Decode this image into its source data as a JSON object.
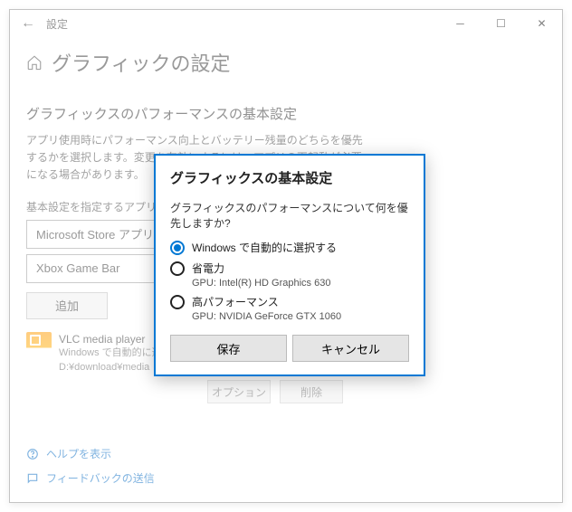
{
  "titlebar": {
    "title": "設定"
  },
  "page": {
    "heading": "グラフィックの設定",
    "subhead": "グラフィックスのパフォーマンスの基本設定",
    "desc": "アプリ使用時にパフォーマンス向上とバッテリー残量のどちらを優先するかを選択します。変更を有効にするには、アプリの再起動が必要になる場合があります。",
    "label": "基本設定を指定するアプリを選択します",
    "dropdown1": "Microsoft Store アプリ",
    "dropdown2": "Xbox Game Bar",
    "add": "追加",
    "app": {
      "name": "VLC media player",
      "sub1": "Windows で自動的に選択",
      "sub2": "D:¥download¥media"
    },
    "btn_option": "オプション",
    "btn_remove": "削除"
  },
  "footer": {
    "help": "ヘルプを表示",
    "feedback": "フィードバックの送信"
  },
  "dialog": {
    "title": "グラフィックスの基本設定",
    "question": "グラフィックスのパフォーマンスについて何を優先しますか?",
    "opt_auto": "Windows で自動的に選択する",
    "opt_power": "省電力",
    "gpu_power": "GPU: Intel(R) HD Graphics 630",
    "opt_perf": "高パフォーマンス",
    "gpu_perf": "GPU: NVIDIA GeForce GTX 1060",
    "save": "保存",
    "cancel": "キャンセル"
  }
}
